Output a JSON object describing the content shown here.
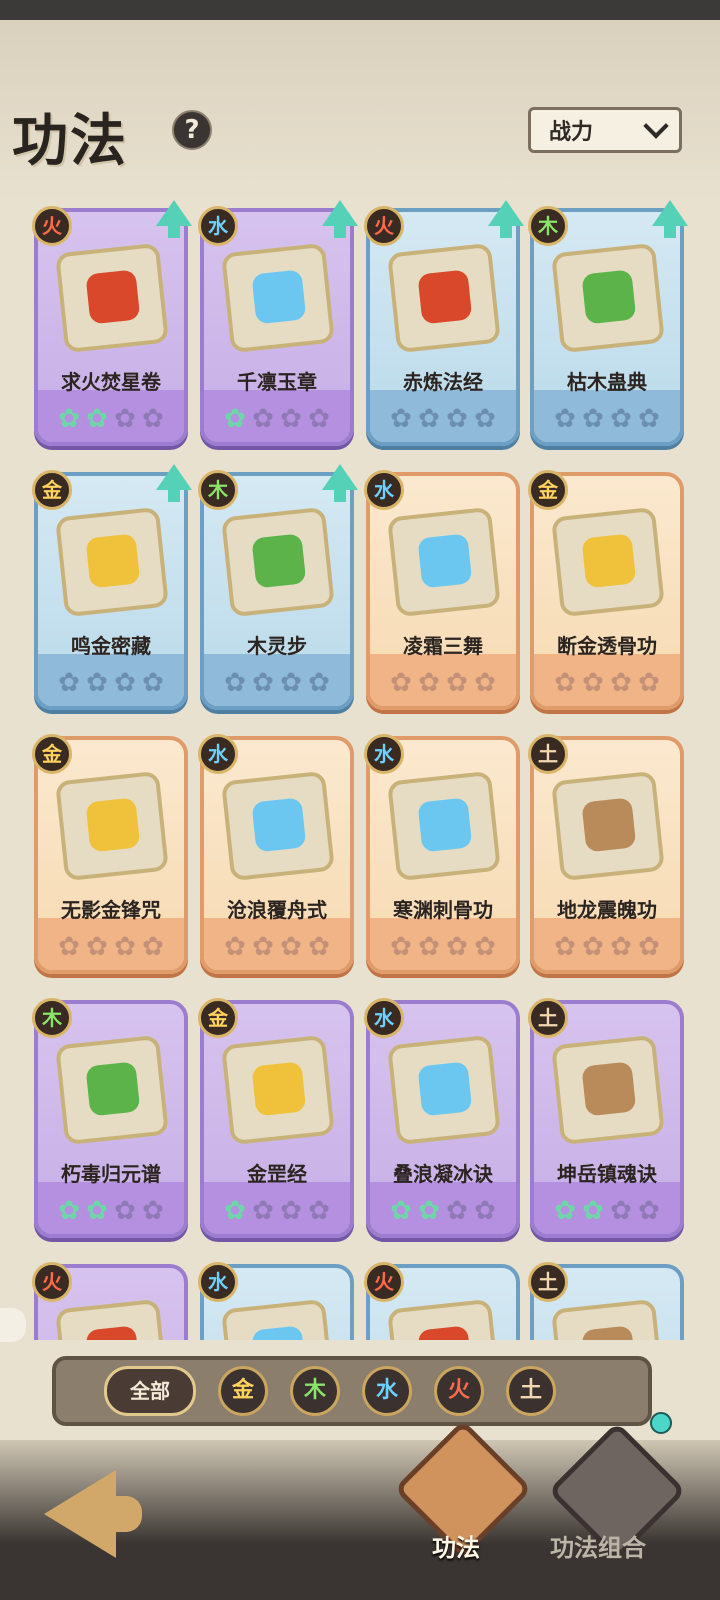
{
  "header": {
    "title": "功法",
    "help_label": "?",
    "sort_label": "战力"
  },
  "cards": [
    {
      "name": "求火焚星卷",
      "element": "火",
      "rarity": "purple",
      "upgrade": true,
      "stars": [
        1,
        1,
        0,
        0
      ]
    },
    {
      "name": "千凛玉章",
      "element": "水",
      "rarity": "purple",
      "upgrade": true,
      "stars": [
        1,
        0,
        0,
        0
      ]
    },
    {
      "name": "赤炼法经",
      "element": "火",
      "rarity": "blue",
      "upgrade": true,
      "stars": [
        1,
        1,
        1,
        0
      ]
    },
    {
      "name": "枯木蛊典",
      "element": "木",
      "rarity": "blue",
      "upgrade": true,
      "stars": [
        1,
        1,
        0,
        0
      ]
    },
    {
      "name": "鸣金密藏",
      "element": "金",
      "rarity": "blue",
      "upgrade": true,
      "stars": [
        1,
        1,
        0,
        0
      ]
    },
    {
      "name": "木灵步",
      "element": "木",
      "rarity": "blue",
      "upgrade": true,
      "stars": [
        1,
        1,
        0,
        0
      ]
    },
    {
      "name": "凌霜三舞",
      "element": "水",
      "rarity": "orange",
      "upgrade": false,
      "stars": [
        1,
        0,
        0,
        0
      ]
    },
    {
      "name": "断金透骨功",
      "element": "金",
      "rarity": "orange",
      "upgrade": false,
      "stars": [
        0,
        0,
        0,
        0
      ]
    },
    {
      "name": "无影金锋咒",
      "element": "金",
      "rarity": "orange",
      "upgrade": false,
      "stars": [
        0,
        0,
        0,
        0
      ]
    },
    {
      "name": "沧浪覆舟式",
      "element": "水",
      "rarity": "orange",
      "upgrade": false,
      "stars": [
        0,
        0,
        0,
        0
      ]
    },
    {
      "name": "寒渊刺骨功",
      "element": "水",
      "rarity": "orange",
      "upgrade": false,
      "stars": [
        0,
        0,
        0,
        0
      ]
    },
    {
      "name": "地龙震魄功",
      "element": "土",
      "rarity": "orange",
      "upgrade": false,
      "stars": [
        0,
        0,
        0,
        0
      ]
    },
    {
      "name": "朽毒归元谱",
      "element": "木",
      "rarity": "purple",
      "upgrade": false,
      "stars": [
        1,
        1,
        0,
        0
      ]
    },
    {
      "name": "金罡经",
      "element": "金",
      "rarity": "purple",
      "upgrade": false,
      "stars": [
        1,
        0,
        0,
        0
      ]
    },
    {
      "name": "叠浪凝冰诀",
      "element": "水",
      "rarity": "purple",
      "upgrade": false,
      "stars": [
        1,
        1,
        0,
        0
      ]
    },
    {
      "name": "坤岳镇魂诀",
      "element": "土",
      "rarity": "purple",
      "upgrade": false,
      "stars": [
        1,
        1,
        0,
        0
      ]
    },
    {
      "name": "",
      "element": "火",
      "rarity": "purple",
      "upgrade": false,
      "stars": [
        0,
        0,
        0,
        0
      ]
    },
    {
      "name": "",
      "element": "水",
      "rarity": "blue",
      "upgrade": false,
      "stars": [
        0,
        0,
        0,
        0
      ]
    },
    {
      "name": "",
      "element": "火",
      "rarity": "blue",
      "upgrade": false,
      "stars": [
        0,
        0,
        0,
        0
      ]
    },
    {
      "name": "",
      "element": "土",
      "rarity": "blue",
      "upgrade": false,
      "stars": [
        0,
        0,
        0,
        0
      ]
    }
  ],
  "filters": [
    "全部",
    "金",
    "木",
    "水",
    "火",
    "土"
  ],
  "bottom_tabs": {
    "tab1": "功法",
    "tab2": "功法组合"
  }
}
